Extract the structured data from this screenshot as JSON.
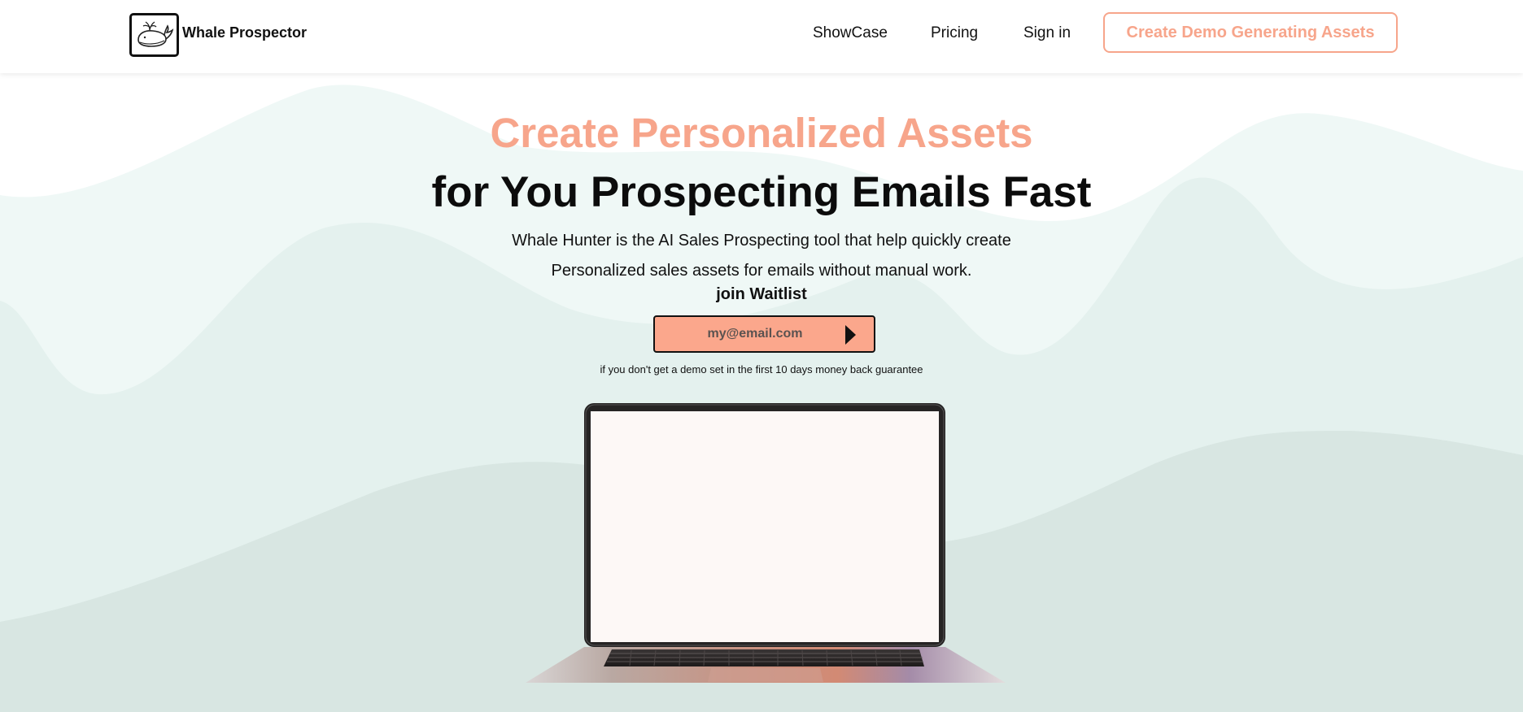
{
  "brand": {
    "name": "Whale Prospector",
    "logo_icon": "whale-icon"
  },
  "nav": {
    "links": [
      "ShowCase",
      "Pricing",
      "Sign in"
    ],
    "cta_label": "Create Demo Generating Assets"
  },
  "hero": {
    "title_line_1": "Create Personalized Assets",
    "title_line_2": "for You Prospecting Emails Fast",
    "description_line_1": "Whale Hunter is the AI Sales Prospecting tool that help quickly create",
    "description_line_2": "Personalized sales assets for emails without manual work.",
    "waitlist_label": "join Waitlist",
    "email_placeholder": "my@email.com",
    "submit_icon": "play-arrow-icon",
    "guarantee": "if you don't get a demo set in the first 10 days money back guarantee"
  },
  "colors": {
    "accent": "#f7a58b",
    "email_box": "#fba78c",
    "text": "#111111",
    "wave_light": "#eff8f6",
    "wave_mid": "#e4f1ee",
    "wave_dark": "#d8e6e2"
  }
}
